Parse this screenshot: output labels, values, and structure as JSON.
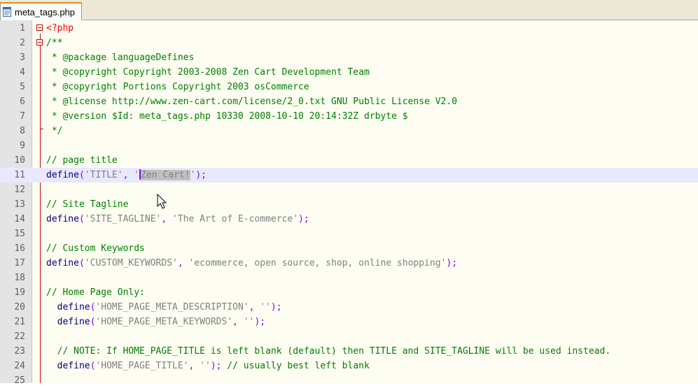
{
  "tab": {
    "filename": "meta_tags.php"
  },
  "lines": [
    {
      "n": "1",
      "php_open": "<?php"
    },
    {
      "n": "2",
      "comment": "/**"
    },
    {
      "n": "3",
      "comment": " * @package languageDefines"
    },
    {
      "n": "4",
      "comment": " * @copyright Copyright 2003-2008 Zen Cart Development Team"
    },
    {
      "n": "5",
      "comment": " * @copyright Portions Copyright 2003 osCommerce"
    },
    {
      "n": "6",
      "comment": " * @license http://www.zen-cart.com/license/2_0.txt GNU Public License V2.0"
    },
    {
      "n": "7",
      "comment": " * @version $Id: meta_tags.php 10330 2008-10-10 20:14:32Z drbyte $"
    },
    {
      "n": "8",
      "comment": " */"
    },
    {
      "n": "9"
    },
    {
      "n": "10",
      "comment": "// page title"
    },
    {
      "n": "11",
      "fn": "define",
      "key": "'TITLE'",
      "value": "Zen Cart!"
    },
    {
      "n": "12"
    },
    {
      "n": "13",
      "comment": "// Site Tagline"
    },
    {
      "n": "14",
      "fn": "define",
      "key": "'SITE_TAGLINE'",
      "value": "'The Art of E-commerce'"
    },
    {
      "n": "15"
    },
    {
      "n": "16",
      "comment": "// Custom Keywords"
    },
    {
      "n": "17",
      "fn": "define",
      "key": "'CUSTOM_KEYWORDS'",
      "value": "'ecommerce, open source, shop, online shopping'"
    },
    {
      "n": "18"
    },
    {
      "n": "19",
      "comment": "// Home Page Only:"
    },
    {
      "n": "20",
      "indent": "  ",
      "fn": "define",
      "key": "'HOME_PAGE_META_DESCRIPTION'",
      "value": "''"
    },
    {
      "n": "21",
      "indent": "  ",
      "fn": "define",
      "key": "'HOME_PAGE_META_KEYWORDS'",
      "value": "''"
    },
    {
      "n": "22"
    },
    {
      "n": "23",
      "comment": "  // NOTE: If HOME_PAGE_TITLE is left blank (default) then TITLE and SITE_TAGLINE will be used instead."
    },
    {
      "n": "24",
      "indent": "  ",
      "fn": "define",
      "key": "'HOME_PAGE_TITLE'",
      "value": "''",
      "trail_comment": " // usually best left blank"
    },
    {
      "n": "25"
    }
  ],
  "colors": {
    "php_tag": "#ff0000",
    "comment": "#008000",
    "keyword": "#000080",
    "operator": "#8000ff",
    "string": "#808080",
    "current_line": "#e8e8ff"
  }
}
